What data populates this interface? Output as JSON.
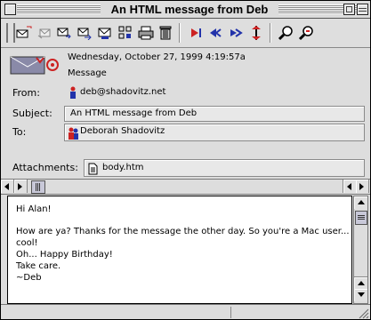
{
  "window": {
    "title": "An HTML message from Deb"
  },
  "toolbar": {
    "buttons": [
      {
        "name": "compose-icon"
      },
      {
        "name": "reply-icon"
      },
      {
        "name": "reply-all-icon"
      },
      {
        "name": "forward-icon"
      },
      {
        "name": "redirect-icon"
      },
      {
        "name": "attach-icon"
      },
      {
        "name": "print-icon"
      },
      {
        "name": "trash-icon"
      },
      {
        "name": "previous-message-icon"
      },
      {
        "name": "next-message-icon"
      },
      {
        "name": "move-icon"
      },
      {
        "name": "priority-icon"
      },
      {
        "name": "find-icon"
      },
      {
        "name": "find-again-icon"
      }
    ]
  },
  "header": {
    "date": "Wednesday, October 27, 1999 4:19:57a",
    "type": "Message",
    "from_label": "From:",
    "from_value": "deb@shadovitz.net",
    "subject_label": "Subject:",
    "subject_value": "An HTML message from Deb",
    "to_label": "To:",
    "to_value": "Deborah Shadovitz",
    "attachments_label": "Attachments:",
    "attachment_name": "body.htm"
  },
  "body": {
    "lines": [
      "Hi Alan!",
      "How are ya? Thanks for the message the other day. So you're a Mac user...",
      "cool!",
      "Oh... Happy Birthday!",
      "Take care.",
      "~Deb"
    ]
  },
  "colors": {
    "accent_red": "#cc2222",
    "accent_blue": "#2244aa",
    "scroll_thumb": "#c8c8d8"
  }
}
